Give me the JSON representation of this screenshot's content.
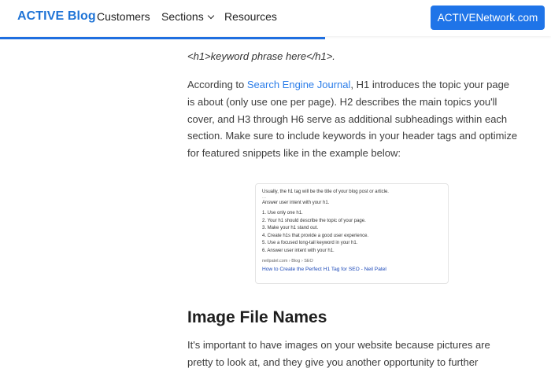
{
  "nav": {
    "brand": "ACTIVE Blog",
    "links": [
      "Customers",
      "Sections",
      "Resources"
    ],
    "cta": "ACTIVENetwork.com"
  },
  "reading_progress": 0.59,
  "article": {
    "code_line": "<h1>keyword phrase here</h1>.",
    "para1": {
      "pre": "According to ",
      "link": "Search Engine Journal",
      "post": ", H1 introduces the topic your page is about (only use one per page). H2 describes the main topics you'll cover, and H3 through H6 serve as additional subheadings within each section. Make sure to include keywords in your header tags and optimize for featured snippets like in the example below:"
    },
    "heading": "Image File Names",
    "para2": "It's important to have images on your website because pictures are pretty to look at, and they give you another opportunity to further describe your"
  },
  "snippet": {
    "intro": "Usually, the h1 tag will be the title of your blog post or article.",
    "dots": "...",
    "subhead": "Answer user intent with your h1.",
    "items": [
      "1. Use only one h1.",
      "2. Your h1 should describe the topic of your page.",
      "3. Make your h1 stand out.",
      "4. Create h1s that provide a good user experience.",
      "5. Use a focused long-tail keyword in your h1.",
      "6. Answer user intent with your h1."
    ],
    "source": "neilpatel.com › Blog › SEO",
    "title": "How to Create the Perfect H1 Tag for SEO - Neil Patel"
  }
}
